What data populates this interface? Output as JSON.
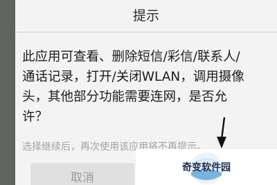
{
  "dialog": {
    "title": "提示",
    "message": "此应用可查看、删除短信/彩信/联系人/\n通话记录，打开/关闭WLAN，调用摄像\n头，其他部分功能需要连网，是否允\n许？",
    "hint": "选择继续后，再次使用该应用将不再提示。",
    "cancel_label": "取消"
  },
  "watermark": {
    "text": "奇变软件园"
  },
  "colors": {
    "dialog_background": "#f3f3f3",
    "side_strip": "#5d6561",
    "hint_text": "#a2a2a2",
    "watermark_text": "#1f2d55"
  }
}
